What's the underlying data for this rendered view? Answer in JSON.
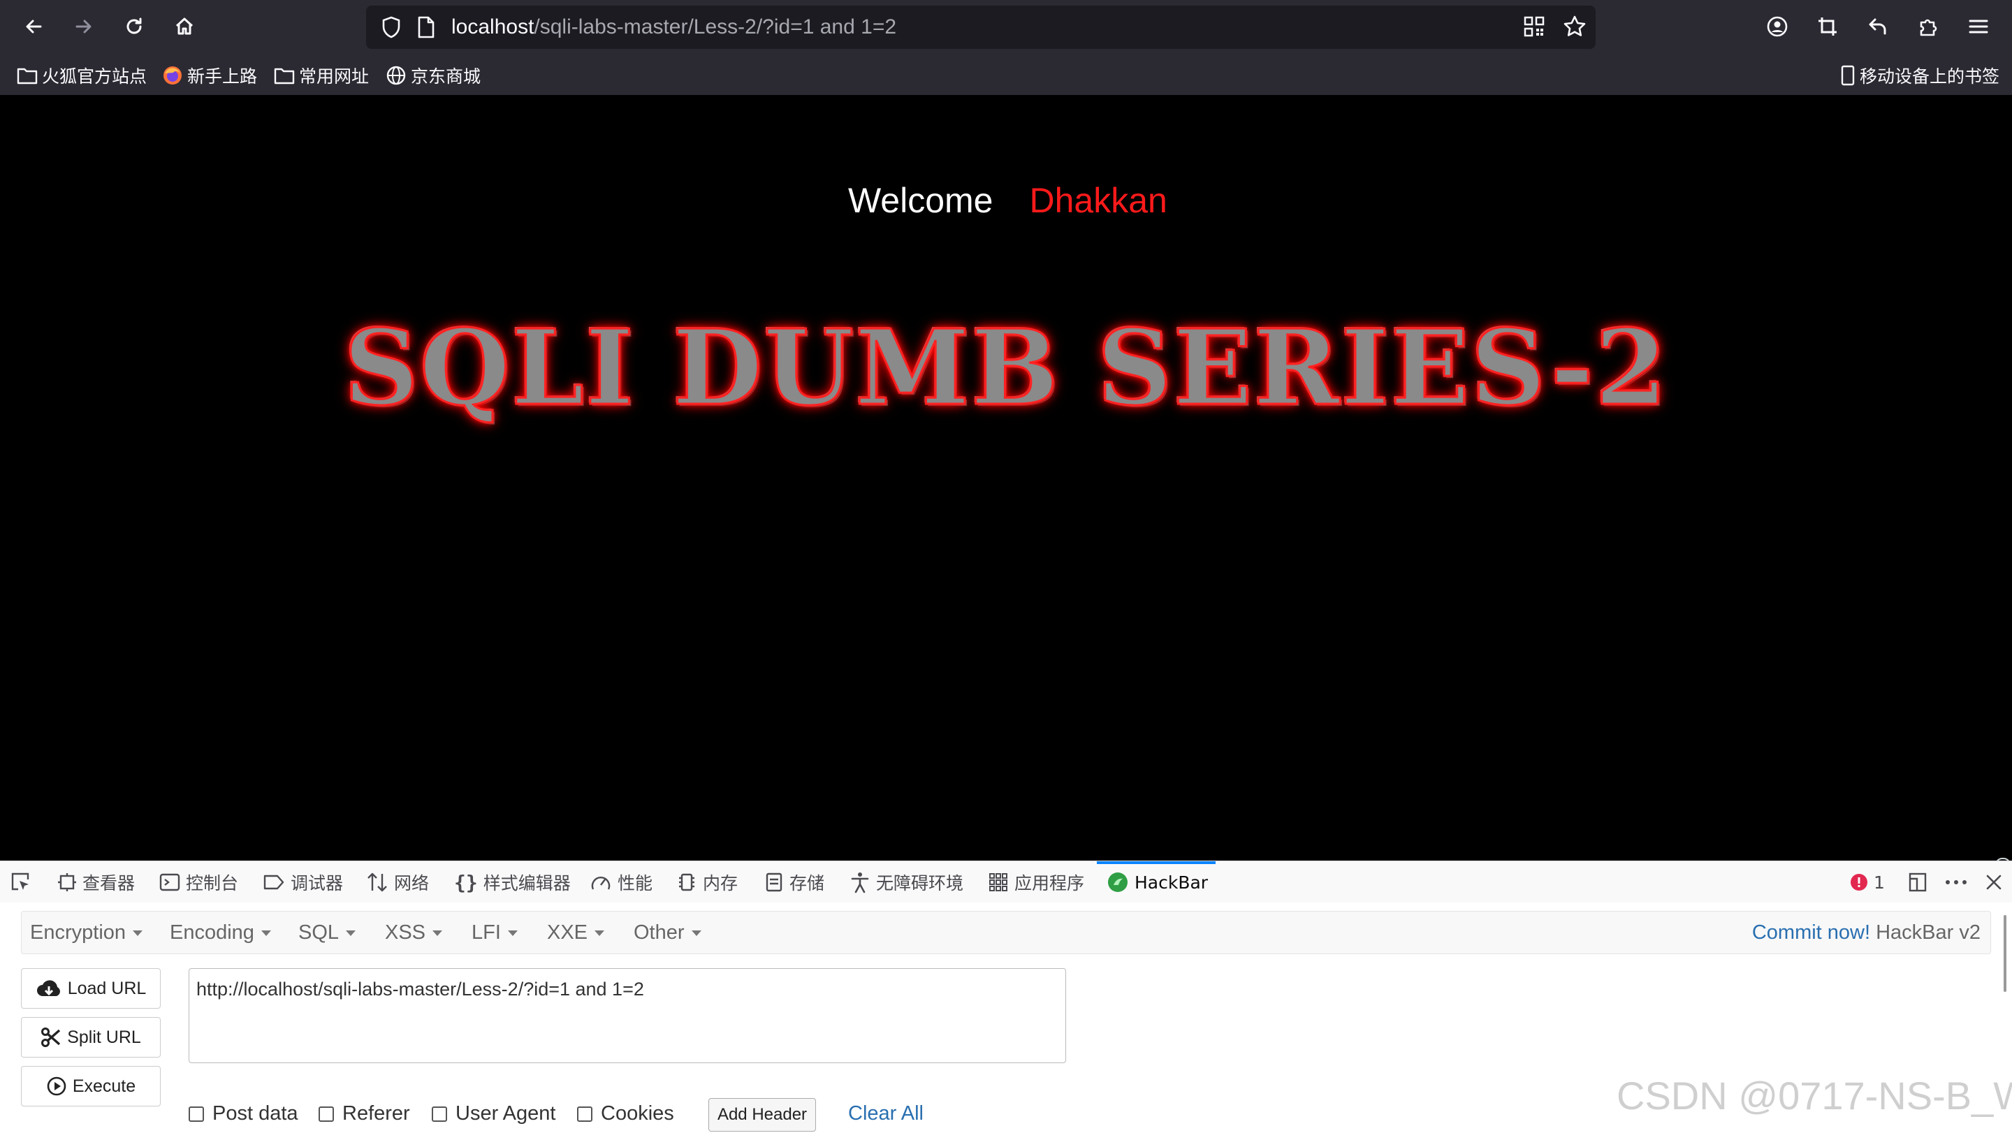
{
  "browser": {
    "url_host": "localhost",
    "url_path": "/sqli-labs-master/Less-2/?id=1 and 1=2",
    "bookmarks": [
      "火狐官方站点",
      "新手上路",
      "常用网址",
      "京东商城"
    ],
    "mobile_bookmarks": "移动设备上的书签"
  },
  "page": {
    "welcome": "Welcome",
    "name": "Dhakkan",
    "banner": "SQLI DUMB SERIES-2"
  },
  "devtools": {
    "tabs": [
      "查看器",
      "控制台",
      "调试器",
      "网络",
      "样式编辑器",
      "性能",
      "内存",
      "存储",
      "无障碍环境",
      "应用程序",
      "HackBar"
    ],
    "error_count": "1"
  },
  "hackbar": {
    "menu": [
      "Encryption",
      "Encoding",
      "SQL",
      "XSS",
      "LFI",
      "XXE",
      "Other"
    ],
    "commit_link": "Commit now!",
    "version": "HackBar v2",
    "buttons": {
      "load": "Load URL",
      "split": "Split URL",
      "execute": "Execute"
    },
    "url_value": "http://localhost/sqli-labs-master/Less-2/?id=1 and 1=2",
    "options": [
      "Post data",
      "Referer",
      "User Agent",
      "Cookies"
    ],
    "add_header": "Add Header",
    "clear_all": "Clear All"
  },
  "watermark": "CSDN @0717-NS-B_W"
}
